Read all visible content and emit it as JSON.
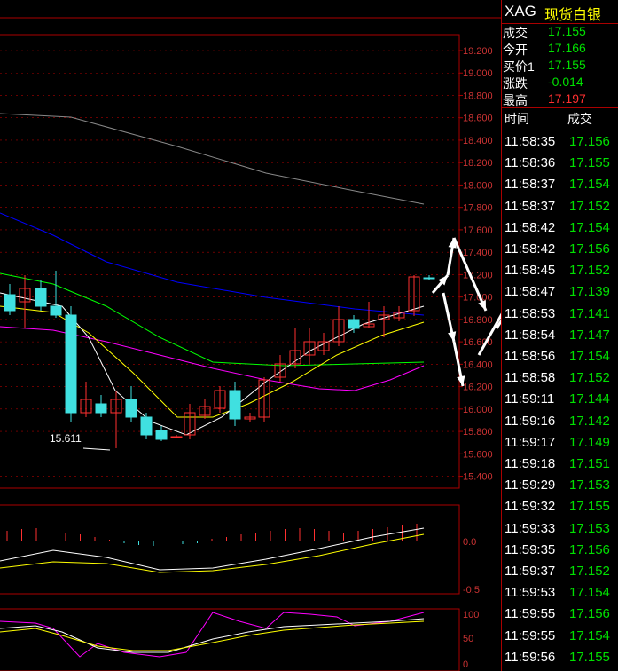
{
  "header": {
    "symbol": "XAG",
    "name": "现货白银"
  },
  "quote": [
    {
      "label": "成交",
      "value": "17.155",
      "color": "#00e000"
    },
    {
      "label": "今开",
      "value": "17.166",
      "color": "#00e000"
    },
    {
      "label": "买价1",
      "value": "17.155",
      "color": "#00e000"
    },
    {
      "label": "涨跌",
      "value": "-0.014",
      "color": "#00e000"
    },
    {
      "label": "最高",
      "value": "17.197",
      "color": "#ff3030"
    }
  ],
  "ticks_header": {
    "time": "时间",
    "price": "成交"
  },
  "ticks": [
    {
      "time": "11:58:35",
      "price": "17.156"
    },
    {
      "time": "11:58:36",
      "price": "17.155"
    },
    {
      "time": "11:58:37",
      "price": "17.154"
    },
    {
      "time": "11:58:37",
      "price": "17.152"
    },
    {
      "time": "11:58:42",
      "price": "17.154"
    },
    {
      "time": "11:58:42",
      "price": "17.156"
    },
    {
      "time": "11:58:45",
      "price": "17.152"
    },
    {
      "time": "11:58:47",
      "price": "17.139"
    },
    {
      "time": "11:58:53",
      "price": "17.141"
    },
    {
      "time": "11:58:54",
      "price": "17.147"
    },
    {
      "time": "11:58:56",
      "price": "17.154"
    },
    {
      "time": "11:58:58",
      "price": "17.152"
    },
    {
      "time": "11:59:11",
      "price": "17.144"
    },
    {
      "time": "11:59:16",
      "price": "17.142"
    },
    {
      "time": "11:59:17",
      "price": "17.149"
    },
    {
      "time": "11:59:18",
      "price": "17.151"
    },
    {
      "time": "11:59:29",
      "price": "17.153"
    },
    {
      "time": "11:59:32",
      "price": "17.155"
    },
    {
      "time": "11:59:33",
      "price": "17.153"
    },
    {
      "time": "11:59:35",
      "price": "17.156"
    },
    {
      "time": "11:59:37",
      "price": "17.152"
    },
    {
      "time": "11:59:53",
      "price": "17.154"
    },
    {
      "time": "11:59:55",
      "price": "17.156"
    },
    {
      "time": "11:59:55",
      "price": "17.154"
    },
    {
      "time": "11:59:56",
      "price": "17.155"
    }
  ],
  "tick_color": "#00e000",
  "price_axis": [
    "19.200",
    "19.000",
    "18.800",
    "18.600",
    "18.400",
    "18.200",
    "18.000",
    "17.800",
    "17.600",
    "17.400",
    "17.200",
    "17.000",
    "16.800",
    "16.600",
    "16.400",
    "16.200",
    "16.000",
    "15.800",
    "15.600",
    "15.400"
  ],
  "low_label": "15.611",
  "macd_axis": [
    "0.0",
    "-0.5"
  ],
  "kdj_axis": [
    "100",
    "50",
    "0"
  ],
  "colors": {
    "up": "#ff3030",
    "down": "#40e0e0",
    "ma1": "#ffffff",
    "ma2": "#ffff00",
    "ma3": "#ff00ff",
    "ma4": "#00ff00",
    "ma5": "#0000ff",
    "ma6": "#888888"
  }
}
